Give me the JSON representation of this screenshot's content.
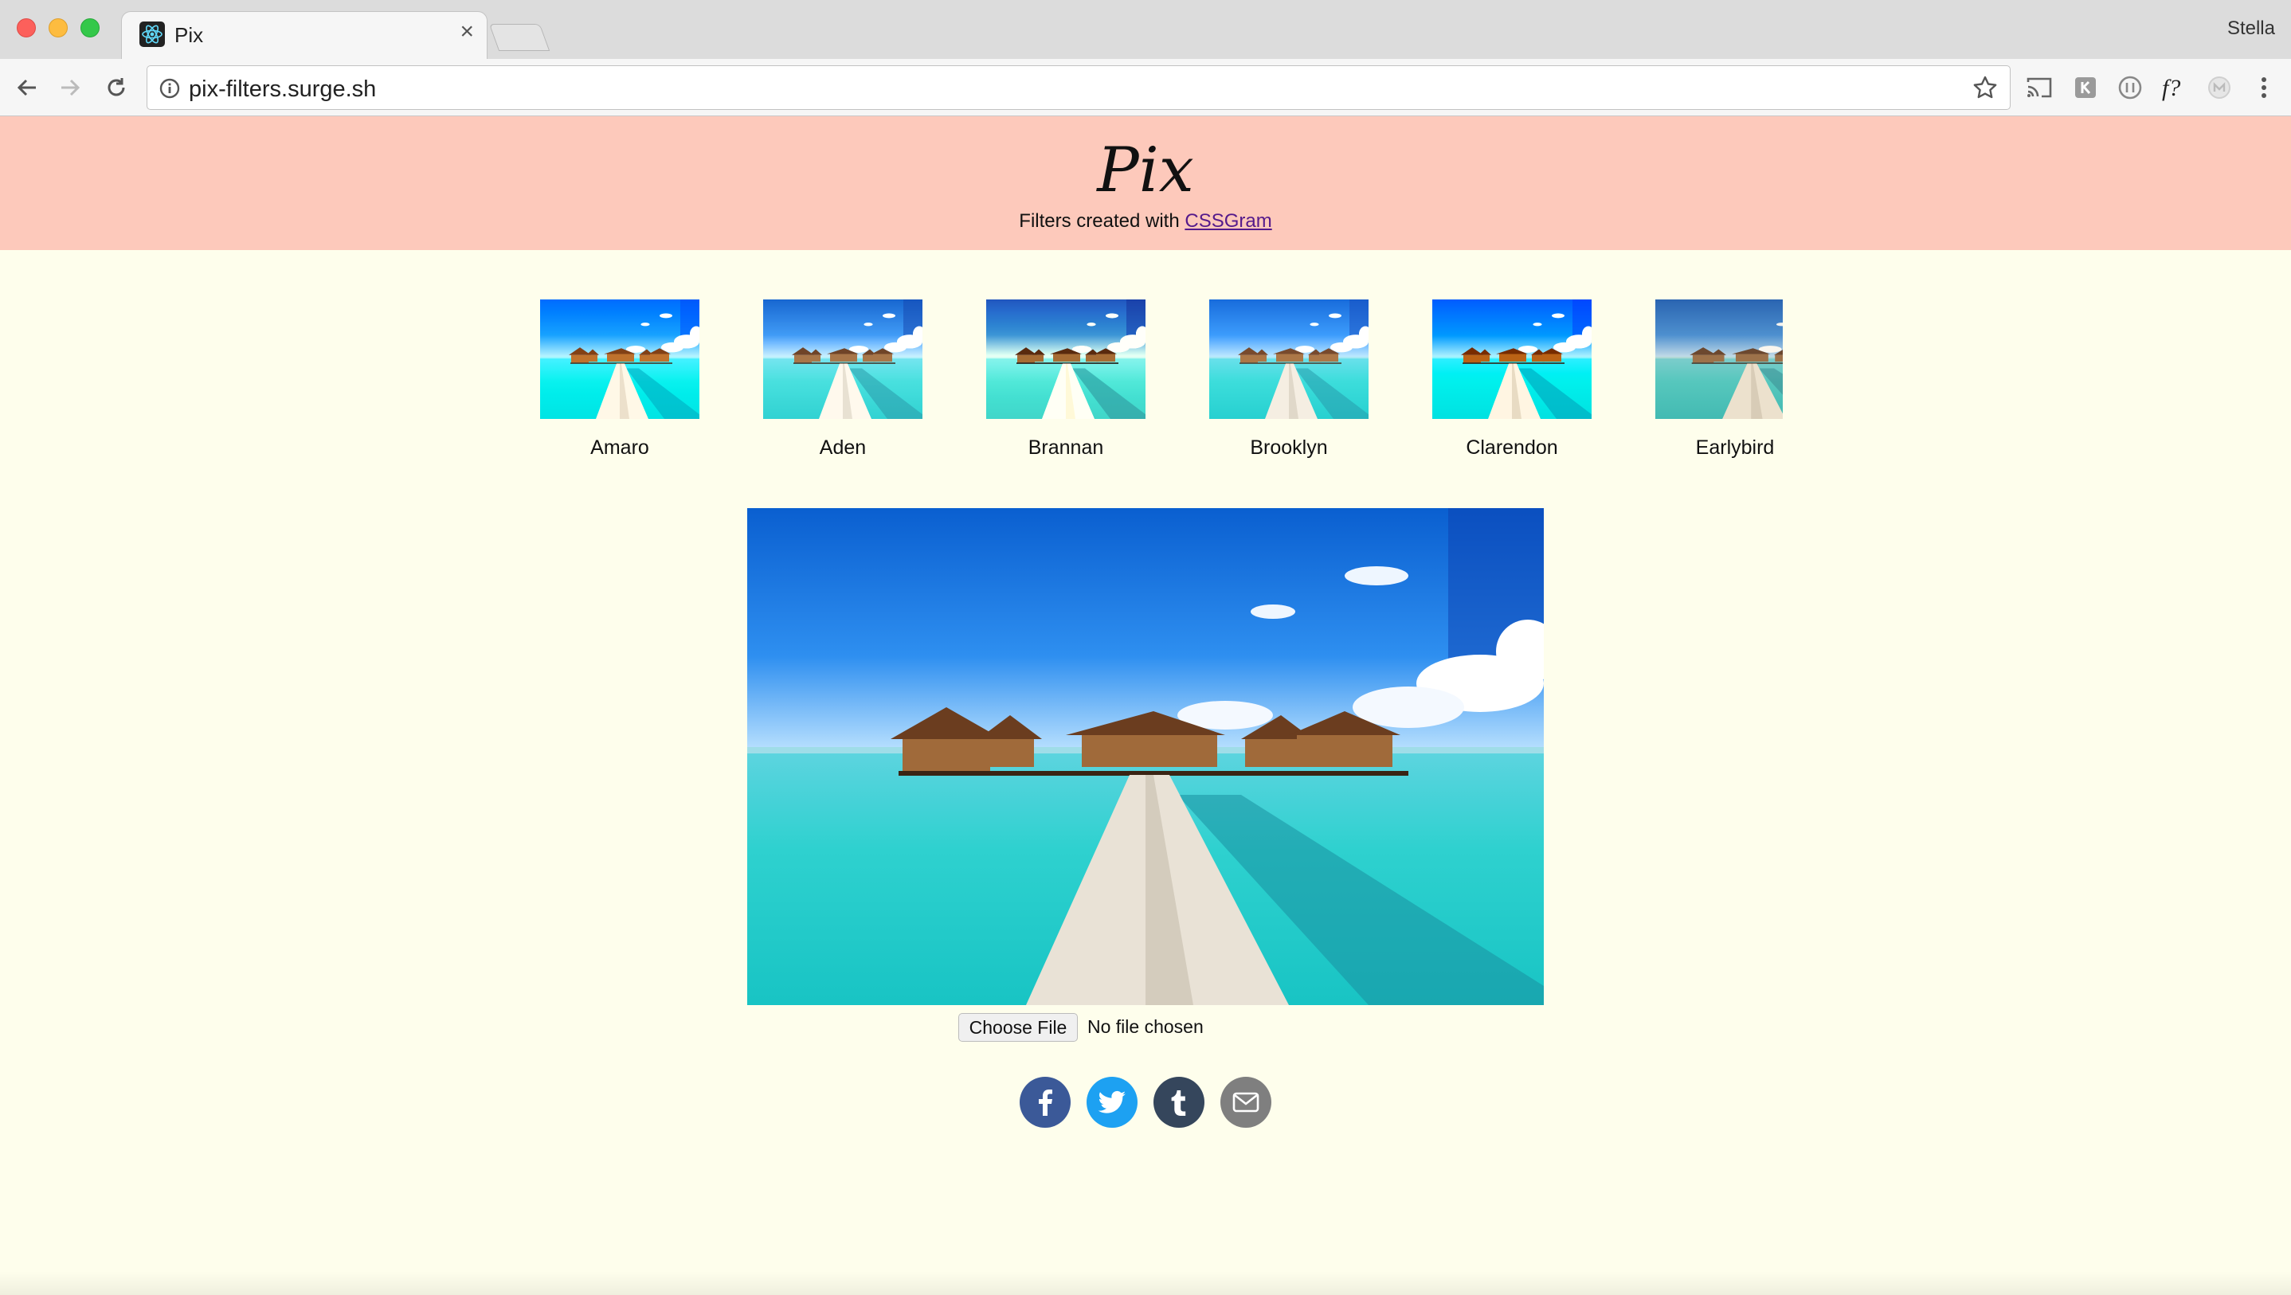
{
  "browser": {
    "tab_title": "Pix",
    "tab_close": "×",
    "profile_name": "Stella",
    "url": "pix-filters.surge.sh",
    "extensions": [
      "cast-icon",
      "k-extension-icon",
      "a-extension-icon",
      "f-extension-icon",
      "m-extension-icon",
      "menu-icon"
    ]
  },
  "header": {
    "logo": "Pix",
    "subtitle_prefix": "Filters created with ",
    "subtitle_link": "CSSGram"
  },
  "filters": [
    {
      "label": "Amaro"
    },
    {
      "label": "Aden"
    },
    {
      "label": "Brannan"
    },
    {
      "label": "Brooklyn"
    },
    {
      "label": "Clarendon"
    },
    {
      "label": "Earlybird"
    }
  ],
  "upload": {
    "button_label": "Choose File",
    "status": "No file chosen"
  },
  "share": [
    "facebook-icon",
    "twitter-icon",
    "tumblr-icon",
    "email-icon"
  ],
  "colors": {
    "header_bg": "#fdc9bb",
    "page_bg": "#fefeec",
    "link": "#551a8b",
    "facebook": "#3b5998",
    "twitter": "#1da1f2",
    "tumblr": "#35465c",
    "email": "#7f7f7f"
  }
}
